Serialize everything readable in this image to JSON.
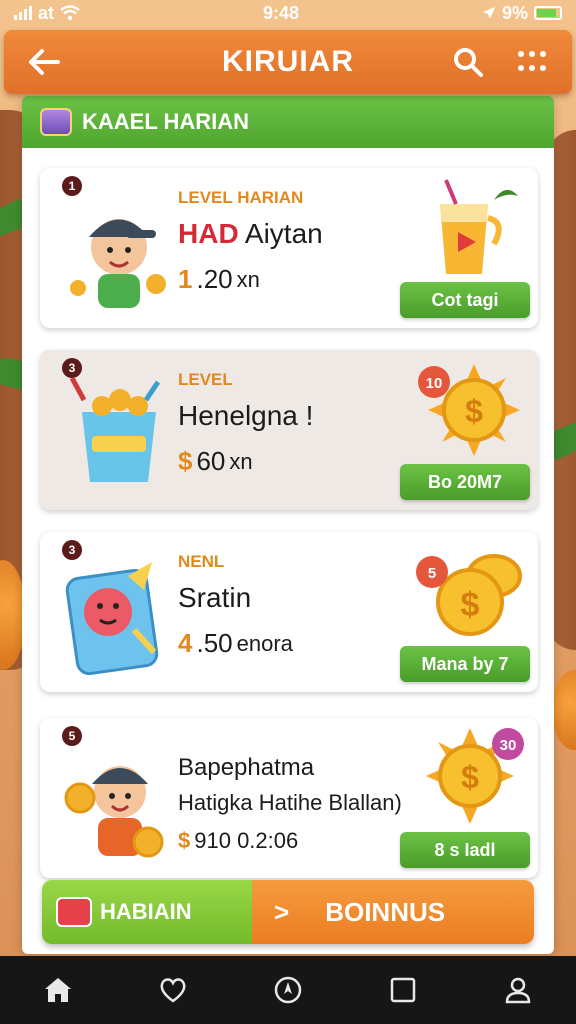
{
  "status_bar": {
    "carrier": "at",
    "time": "9:48",
    "battery": "9%"
  },
  "app_bar": {
    "title": "KIRUIAR"
  },
  "section": {
    "title": "KAAEL HARIAN"
  },
  "cards": [
    {
      "badge": "1",
      "level": "LEVEL HARIAN",
      "name_highlight": "HAD",
      "name": " Aiytan",
      "reward_symbol": "1",
      "reward_value": ".20",
      "reward_unit": "xn",
      "action": "Cot tagi"
    },
    {
      "badge": "3",
      "level": "LEVEL",
      "name": "Henelgna !",
      "reward_symbol": "$",
      "reward_value": " 60",
      "reward_unit": "xn",
      "action": "Bo 20M7",
      "prize_tag": "10"
    },
    {
      "badge": "3",
      "level": "NENL",
      "name": "Sratin",
      "reward_symbol": "4",
      "reward_value": ".50",
      "reward_unit": "enora",
      "action": "Mana by 7",
      "prize_tag": "5"
    },
    {
      "badge": "5",
      "name": "Bapephatma",
      "subtitle": "Hatigka Hatihe Blallan)",
      "reward_symbol": "$",
      "reward_value": " 910 0.2:06",
      "action": "8 s Iadl",
      "prize_tag": "30"
    }
  ],
  "banner": {
    "left_label": "HABIAIN",
    "arrow": ">",
    "right_label": "BOINNUS"
  },
  "colors": {
    "orange": "#e0702a",
    "green": "#4ea62e",
    "coin": "#e3891c",
    "red": "#d42a35"
  }
}
